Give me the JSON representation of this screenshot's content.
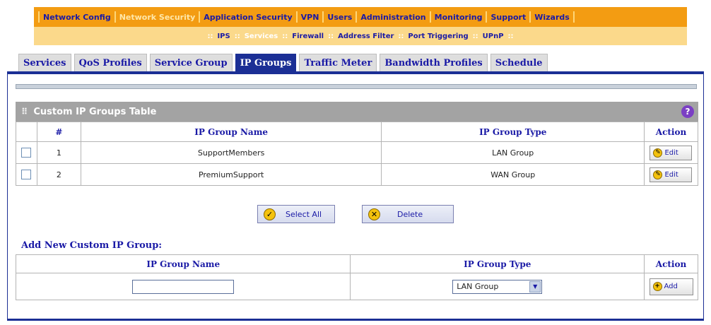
{
  "topnav": {
    "items": [
      {
        "label": "Network Config"
      },
      {
        "label": "Network Security"
      },
      {
        "label": "Application Security"
      },
      {
        "label": "VPN"
      },
      {
        "label": "Users"
      },
      {
        "label": "Administration"
      },
      {
        "label": "Monitoring"
      },
      {
        "label": "Support"
      },
      {
        "label": "Wizards"
      }
    ],
    "active": "Network Security"
  },
  "subnav": {
    "items": [
      {
        "label": "IPS"
      },
      {
        "label": "Services"
      },
      {
        "label": "Firewall"
      },
      {
        "label": "Address Filter"
      },
      {
        "label": "Port Triggering"
      },
      {
        "label": "UPnP"
      }
    ],
    "active": "Services",
    "separator": "::"
  },
  "tabs": [
    {
      "label": "Services"
    },
    {
      "label": "QoS Profiles"
    },
    {
      "label": "Service Group"
    },
    {
      "label": "IP Groups"
    },
    {
      "label": "Traffic Meter"
    },
    {
      "label": "Bandwidth Profiles"
    },
    {
      "label": "Schedule"
    }
  ],
  "active_tab": "IP Groups",
  "section": {
    "title": "Custom IP Groups Table",
    "grip": "⠿",
    "help": "?"
  },
  "table": {
    "headers": {
      "num": "#",
      "name": "IP Group Name",
      "type": "IP Group Type",
      "action": "Action"
    },
    "rows": [
      {
        "num": "1",
        "name": "SupportMembers",
        "type": "LAN Group",
        "action": "Edit"
      },
      {
        "num": "2",
        "name": "PremiumSupport",
        "type": "WAN Group",
        "action": "Edit"
      }
    ]
  },
  "buttons": {
    "select_all": "Select All",
    "delete": "Delete"
  },
  "add": {
    "title": "Add New Custom IP Group:",
    "headers": {
      "name": "IP Group Name",
      "type": "IP Group Type",
      "action": "Action"
    },
    "name_value": "",
    "type_value": "LAN Group",
    "action": "Add"
  },
  "colors": {
    "accent": "#f39c12",
    "nav_text": "#1a1aa6",
    "active_tab": "#1b2f95"
  },
  "icons": {
    "help": "help-icon",
    "edit": "edit-icon",
    "check": "check-icon",
    "delete": "delete-icon",
    "add": "add-icon",
    "dropdown": "chevron-down-icon"
  }
}
